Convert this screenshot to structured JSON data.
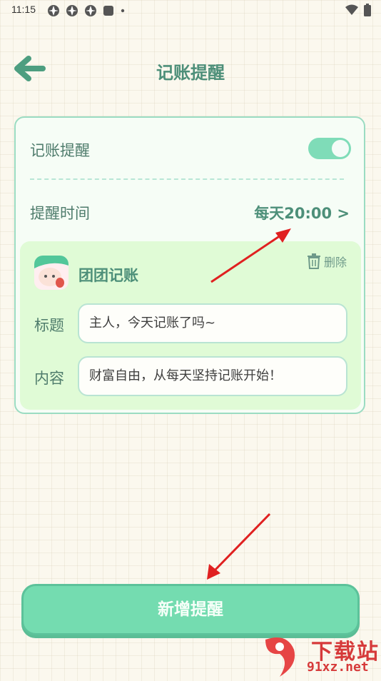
{
  "status_bar": {
    "time": "11:15"
  },
  "header": {
    "title": "记账提醒"
  },
  "settings": {
    "reminder_label": "记账提醒",
    "reminder_enabled": true,
    "time_label": "提醒时间",
    "time_value": "每天20:00 >"
  },
  "preview": {
    "app_name": "团团记账",
    "delete_label": "删除",
    "title_label": "标题",
    "title_value": "主人，今天记账了吗~",
    "content_label": "内容",
    "content_value": "财富自由，从每天坚持记账开始！"
  },
  "add_button": {
    "label": "新增提醒"
  },
  "watermark": {
    "line1": "下载站",
    "line2": "91xz.net"
  },
  "colors": {
    "accent": "#74dcb0",
    "text_green": "#4d8f79",
    "arrow": "#e02020"
  }
}
